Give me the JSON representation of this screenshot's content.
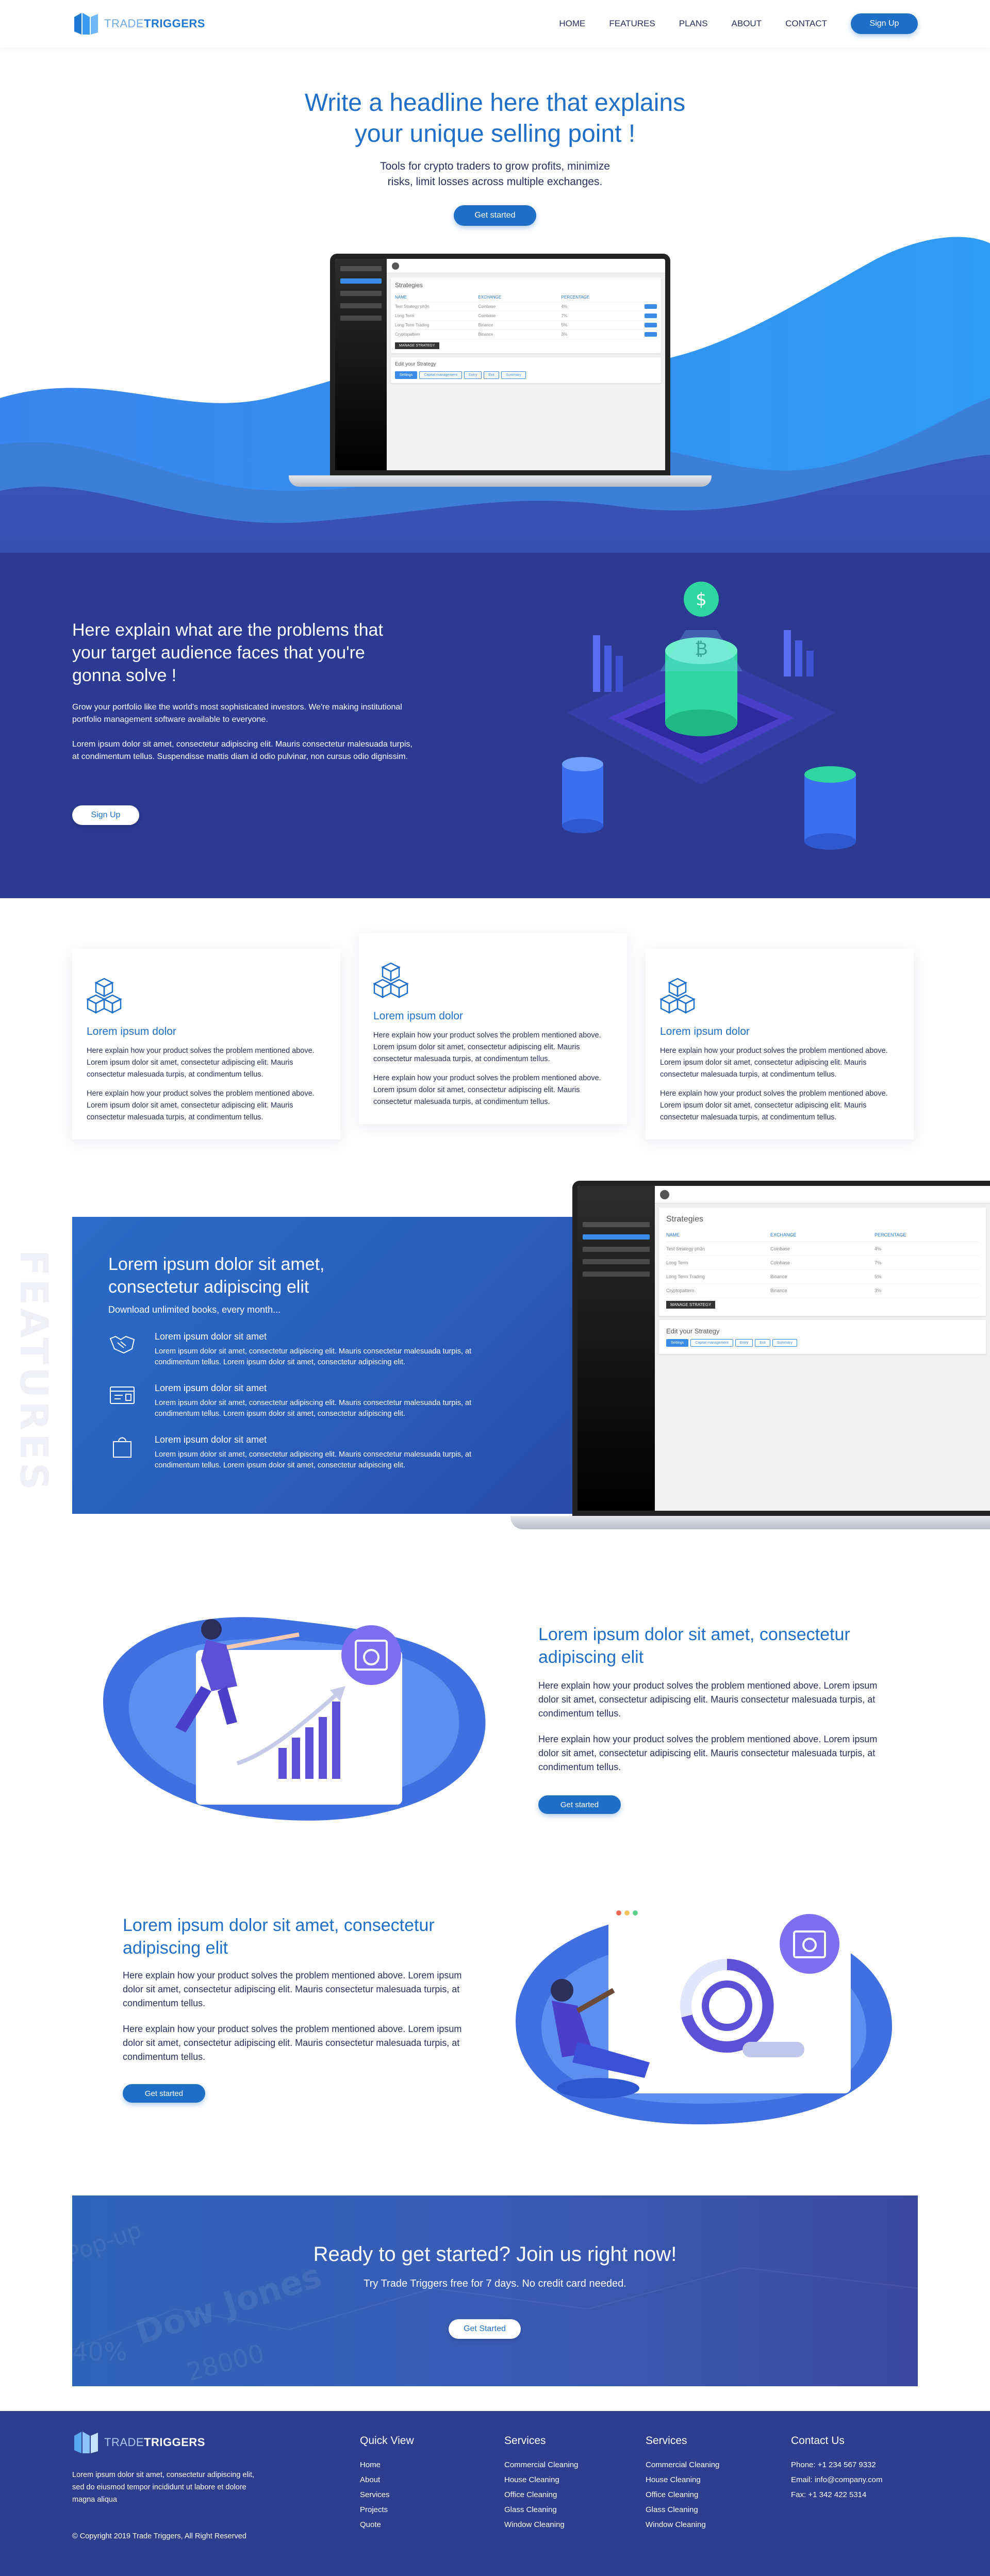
{
  "nav": {
    "logo": {
      "part1": "TRADE",
      "part2": "TRIGGERS"
    },
    "items": [
      "HOME",
      "FEATURES",
      "PLANS",
      "ABOUT",
      "CONTACT"
    ],
    "signup": "Sign Up"
  },
  "hero": {
    "title_line1": "Write a headline here that explains",
    "title_line2": "your unique selling point !",
    "sub_line1": "Tools for crypto traders to grow profits, minimize",
    "sub_line2": "risks, limit losses across multiple exchanges.",
    "cta": "Get started"
  },
  "app": {
    "heading": "Strategies",
    "columns": [
      "NAME",
      "EXCHANGE",
      "PERCENTAGE"
    ],
    "rows": [
      [
        "Test Strategy ph3n",
        "Coinbase",
        "4%"
      ],
      [
        "Long Term",
        "Coinbase",
        "7%"
      ],
      [
        "Long Term Trading",
        "Binance",
        "5%"
      ],
      [
        "Cryptopattern",
        "Binance",
        "3%"
      ]
    ],
    "create_btn": "MANAGE STRATEGY",
    "edit_heading": "Edit your Strategy",
    "tabs": [
      "Settings",
      "Capital management",
      "Entry",
      "Exit",
      "Summary"
    ]
  },
  "problem": {
    "title": "Here explain what are the problems that your target audience faces that you're gonna solve !",
    "p1": "Grow your portfolio like the world's most sophisticated investors. We're making institutional portfolio management software available to everyone.",
    "p2": "Lorem ipsum dolor sit amet, consectetur adipiscing elit. Mauris consectetur malesuada turpis, at condimentum tellus. Suspendisse mattis diam id odio pulvinar, non cursus odio dignissim.",
    "cta": "Sign Up"
  },
  "cards": [
    {
      "title": "Lorem ipsum dolor",
      "p1": "Here explain how your product solves the problem mentioned above. Lorem ipsum dolor sit amet, consectetur adipiscing elit. Mauris consectetur malesuada turpis, at condimentum tellus.",
      "p2": "Here explain how your product solves the problem mentioned above. Lorem ipsum dolor sit amet, consectetur adipiscing elit. Mauris consectetur malesuada turpis, at condimentum tellus."
    },
    {
      "title": "Lorem ipsum dolor",
      "p1": "Here explain how your product solves the problem mentioned above. Lorem ipsum dolor sit amet, consectetur adipiscing elit. Mauris consectetur malesuada turpis, at condimentum tellus.",
      "p2": "Here explain how your product solves the problem mentioned above. Lorem ipsum dolor sit amet, consectetur adipiscing elit. Mauris consectetur malesuada turpis, at condimentum tellus."
    },
    {
      "title": "Lorem ipsum dolor",
      "p1": "Here explain how your product solves the problem mentioned above. Lorem ipsum dolor sit amet, consectetur adipiscing elit. Mauris consectetur malesuada turpis, at condimentum tellus.",
      "p2": "Here explain how your product solves the problem mentioned above. Lorem ipsum dolor sit amet, consectetur adipiscing elit. Mauris consectetur malesuada turpis, at condimentum tellus."
    }
  ],
  "features": {
    "watermark": "FEATURES",
    "title": "Lorem ipsum dolor sit amet, consectetur adipiscing elit",
    "sub": "Download unlimited books, every month...",
    "items": [
      {
        "title": "Lorem ipsum dolor sit amet",
        "text": "Lorem ipsum dolor sit amet, consectetur adipiscing elit. Mauris consectetur malesuada turpis, at condimentum tellus. Lorem ipsum dolor sit amet, consectetur adipiscing elit."
      },
      {
        "title": "Lorem ipsum dolor sit amet",
        "text": "Lorem ipsum dolor sit amet, consectetur adipiscing elit. Mauris consectetur malesuada turpis, at condimentum tellus. Lorem ipsum dolor sit amet, consectetur adipiscing elit."
      },
      {
        "title": "Lorem ipsum dolor sit amet",
        "text": "Lorem ipsum dolor sit amet, consectetur adipiscing elit. Mauris consectetur malesuada turpis, at condimentum tellus. Lorem ipsum dolor sit amet, consectetur adipiscing elit."
      }
    ]
  },
  "split1": {
    "title": "Lorem ipsum dolor sit amet, consectetur adipiscing elit",
    "p1": "Here explain how your product solves the problem mentioned above. Lorem ipsum dolor sit amet, consectetur adipiscing elit. Mauris consectetur malesuada turpis, at condimentum tellus.",
    "p2": "Here explain how your product solves the problem mentioned above. Lorem ipsum dolor sit amet, consectetur adipiscing elit. Mauris consectetur malesuada turpis, at condimentum tellus.",
    "cta": "Get started"
  },
  "split2": {
    "title": "Lorem ipsum dolor sit amet, consectetur adipiscing elit",
    "p1": "Here explain how your product solves the problem mentioned above. Lorem ipsum dolor sit amet, consectetur adipiscing elit. Mauris consectetur malesuada turpis, at condimentum tellus.",
    "p2": "Here explain how your product solves the problem mentioned above. Lorem ipsum dolor sit amet, consectetur adipiscing elit. Mauris consectetur malesuada turpis, at condimentum tellus.",
    "cta": "Get started"
  },
  "cta": {
    "title": "Ready to get started? Join us right now!",
    "sub": "Try Trade Triggers free for 7 days. No credit card needed.",
    "button": "Get Started",
    "bg_words": [
      "Pop-up",
      "Dow Jones",
      "28000",
      "40%"
    ]
  },
  "footer": {
    "about": "Lorem ipsum dolor sit amet, consectetur adipiscing elit, sed do eiusmod tempor incididunt ut labore et dolore magna aliqua",
    "copyright": "© Copyright 2019 Trade Triggers,  All Right Reserved",
    "cols": [
      {
        "title": "Quick View",
        "links": [
          "Home",
          "About",
          "Services",
          "Projects",
          "Quote"
        ]
      },
      {
        "title": "Services",
        "links": [
          "Commercial Cleaning",
          "House Cleaning",
          "Office Cleaning",
          "Glass Cleaning",
          "Window Cleaning"
        ]
      },
      {
        "title": "Services",
        "links": [
          "Commercial Cleaning",
          "House Cleaning",
          "Office Cleaning",
          "Glass Cleaning",
          "Window Cleaning"
        ]
      },
      {
        "title": "Contact Us",
        "links": [
          "Phone: +1 234 567 9332",
          "Email: info@company.com",
          "Fax: +1 342 422 5314"
        ]
      }
    ]
  },
  "colors": {
    "brand_blue": "#1f6fc9",
    "deep_navy": "#2b3a8f",
    "footer": "#2e3e8e",
    "wave_light": "#2f8ff0"
  }
}
